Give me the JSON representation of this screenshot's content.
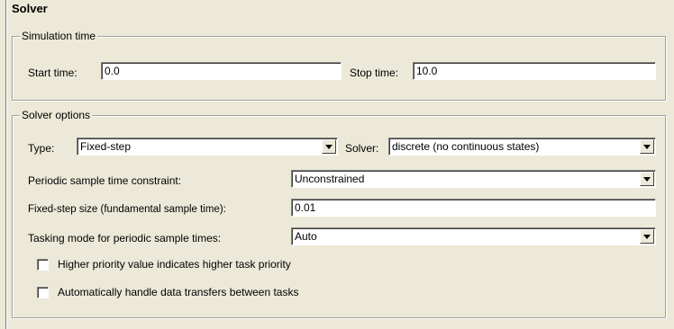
{
  "panel": {
    "title": "Solver"
  },
  "simulation_time": {
    "legend": "Simulation time",
    "start_label": "Start time:",
    "start_value": "0.0",
    "stop_label": "Stop time:",
    "stop_value": "10.0"
  },
  "solver_options": {
    "legend": "Solver options",
    "type_label": "Type:",
    "type_value": "Fixed-step",
    "solver_label": "Solver:",
    "solver_value": "discrete (no continuous states)",
    "periodic_label": "Periodic sample time constraint:",
    "periodic_value": "Unconstrained",
    "fixed_step_label": "Fixed-step size (fundamental sample time):",
    "fixed_step_value": "0.01",
    "tasking_label": "Tasking mode for periodic sample times:",
    "tasking_value": "Auto",
    "priority_checkbox_label": "Higher priority value indicates higher task priority",
    "priority_checked": false,
    "transfers_checkbox_label": "Automatically handle data transfers between tasks",
    "transfers_checked": false
  }
}
